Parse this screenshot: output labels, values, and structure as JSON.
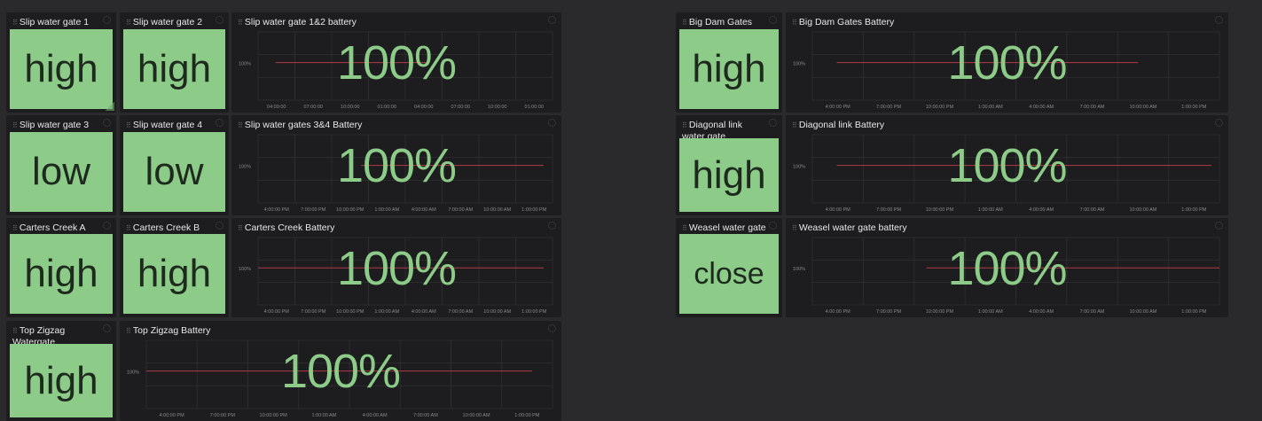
{
  "colors": {
    "background": "#2a2a2c",
    "panel": "#1d1d1f",
    "tile_green": "#8ccc88",
    "value_green": "#8ccc88",
    "line_red": "#b03a48",
    "grid": "#2c2c2f"
  },
  "gate_panels": [
    {
      "id": "g1",
      "title": "Slip water gate 1",
      "value": "high"
    },
    {
      "id": "g2",
      "title": "Slip water gate 2",
      "value": "high"
    },
    {
      "id": "g3",
      "title": "Slip water gate 3",
      "value": "low"
    },
    {
      "id": "g4",
      "title": "Slip water gate 4",
      "value": "low"
    },
    {
      "id": "g5",
      "title": "Carters Creek A",
      "value": "high"
    },
    {
      "id": "g6",
      "title": "Carters Creek B",
      "value": "high"
    },
    {
      "id": "g7",
      "title": "Top Zigzag Watergate",
      "value": "high"
    },
    {
      "id": "g8",
      "title": "Big Dam Gates",
      "value": "high"
    },
    {
      "id": "g9",
      "title": "Diagonal link water gate",
      "value": "high"
    },
    {
      "id": "g10",
      "title": "Weasel water gate",
      "value": "close"
    }
  ],
  "battery_panels": [
    {
      "id": "b1",
      "title": "Slip water gate 1&2 battery",
      "value": "100%"
    },
    {
      "id": "b2",
      "title": "Slip water gates 3&4 Battery",
      "value": "100%"
    },
    {
      "id": "b3",
      "title": "Carters Creek Battery",
      "value": "100%"
    },
    {
      "id": "b4",
      "title": "Top Zigzag Battery",
      "value": "100%"
    },
    {
      "id": "b5",
      "title": "Big Dam Gates Battery",
      "value": "100%"
    },
    {
      "id": "b6",
      "title": "Diagonal link Battery",
      "value": "100%"
    },
    {
      "id": "b7",
      "title": "Weasel water gate battery",
      "value": "100%"
    }
  ],
  "chart_data": [
    {
      "type": "line",
      "title": "Slip water gate 1&2 battery",
      "y_tick": "100%",
      "x_ticks": [
        "04:00:00",
        "07:00:00",
        "10:00:00",
        "01:00:00",
        "04:00:00",
        "07:00:00",
        "10:00:00",
        "01:00:00"
      ],
      "series": [
        {
          "values": [
            100,
            100
          ]
        }
      ],
      "x_range": [
        0.06,
        0.58
      ]
    },
    {
      "type": "line",
      "title": "Slip water gates 3&4 Battery",
      "y_tick": "100%",
      "x_ticks": [
        "4:00:00 PM",
        "7:00:00 PM",
        "10:00:00 PM",
        "1:00:00 AM",
        "4:00:00 AM",
        "7:00:00 AM",
        "10:00:00 AM",
        "1:00:00 PM"
      ],
      "series": [
        {
          "values": [
            100,
            100
          ]
        }
      ],
      "x_range": [
        0.35,
        0.97
      ]
    },
    {
      "type": "line",
      "title": "Carters Creek Battery",
      "y_tick": "100%",
      "x_ticks": [
        "4:00:00 PM",
        "7:00:00 PM",
        "10:00:00 PM",
        "1:00:00 AM",
        "4:00:00 AM",
        "7:00:00 AM",
        "10:00:00 AM",
        "1:00:00 PM"
      ],
      "series": [
        {
          "values": [
            100,
            100
          ]
        }
      ],
      "x_range": [
        0.0,
        0.97
      ]
    },
    {
      "type": "line",
      "title": "Top Zigzag Battery",
      "y_tick": "100%",
      "x_ticks": [
        "4:00:00 PM",
        "7:00:00 PM",
        "10:00:00 PM",
        "1:00:00 AM",
        "4:00:00 AM",
        "7:00:00 AM",
        "10:00:00 AM",
        "1:00:00 PM"
      ],
      "series": [
        {
          "values": [
            100,
            100
          ]
        }
      ],
      "x_range": [
        0.0,
        0.95
      ]
    },
    {
      "type": "line",
      "title": "Big Dam Gates Battery",
      "y_tick": "100%",
      "x_ticks": [
        "4:00:00 PM",
        "7:00:00 PM",
        "10:00:00 PM",
        "1:00:00 AM",
        "4:00:00 AM",
        "7:00:00 AM",
        "10:00:00 AM",
        "1:00:00 PM"
      ],
      "series": [
        {
          "values": [
            100,
            100
          ]
        }
      ],
      "x_range": [
        0.06,
        0.8
      ]
    },
    {
      "type": "line",
      "title": "Diagonal link Battery",
      "y_tick": "100%",
      "x_ticks": [
        "4:00:00 PM",
        "7:00:00 PM",
        "10:00:00 PM",
        "1:00:00 AM",
        "4:00:00 AM",
        "7:00:00 AM",
        "10:00:00 AM",
        "1:00:00 PM"
      ],
      "series": [
        {
          "values": [
            100,
            100
          ]
        }
      ],
      "x_range": [
        0.06,
        0.98
      ]
    },
    {
      "type": "line",
      "title": "Weasel water gate battery",
      "y_tick": "100%",
      "x_ticks": [
        "4:00:00 PM",
        "7:00:00 PM",
        "10:00:00 PM",
        "1:00:00 AM",
        "4:00:00 AM",
        "7:00:00 AM",
        "10:00:00 AM",
        "1:00:00 PM"
      ],
      "series": [
        {
          "values": [
            100,
            100
          ]
        }
      ],
      "x_range": [
        0.28,
        1.0
      ]
    }
  ]
}
